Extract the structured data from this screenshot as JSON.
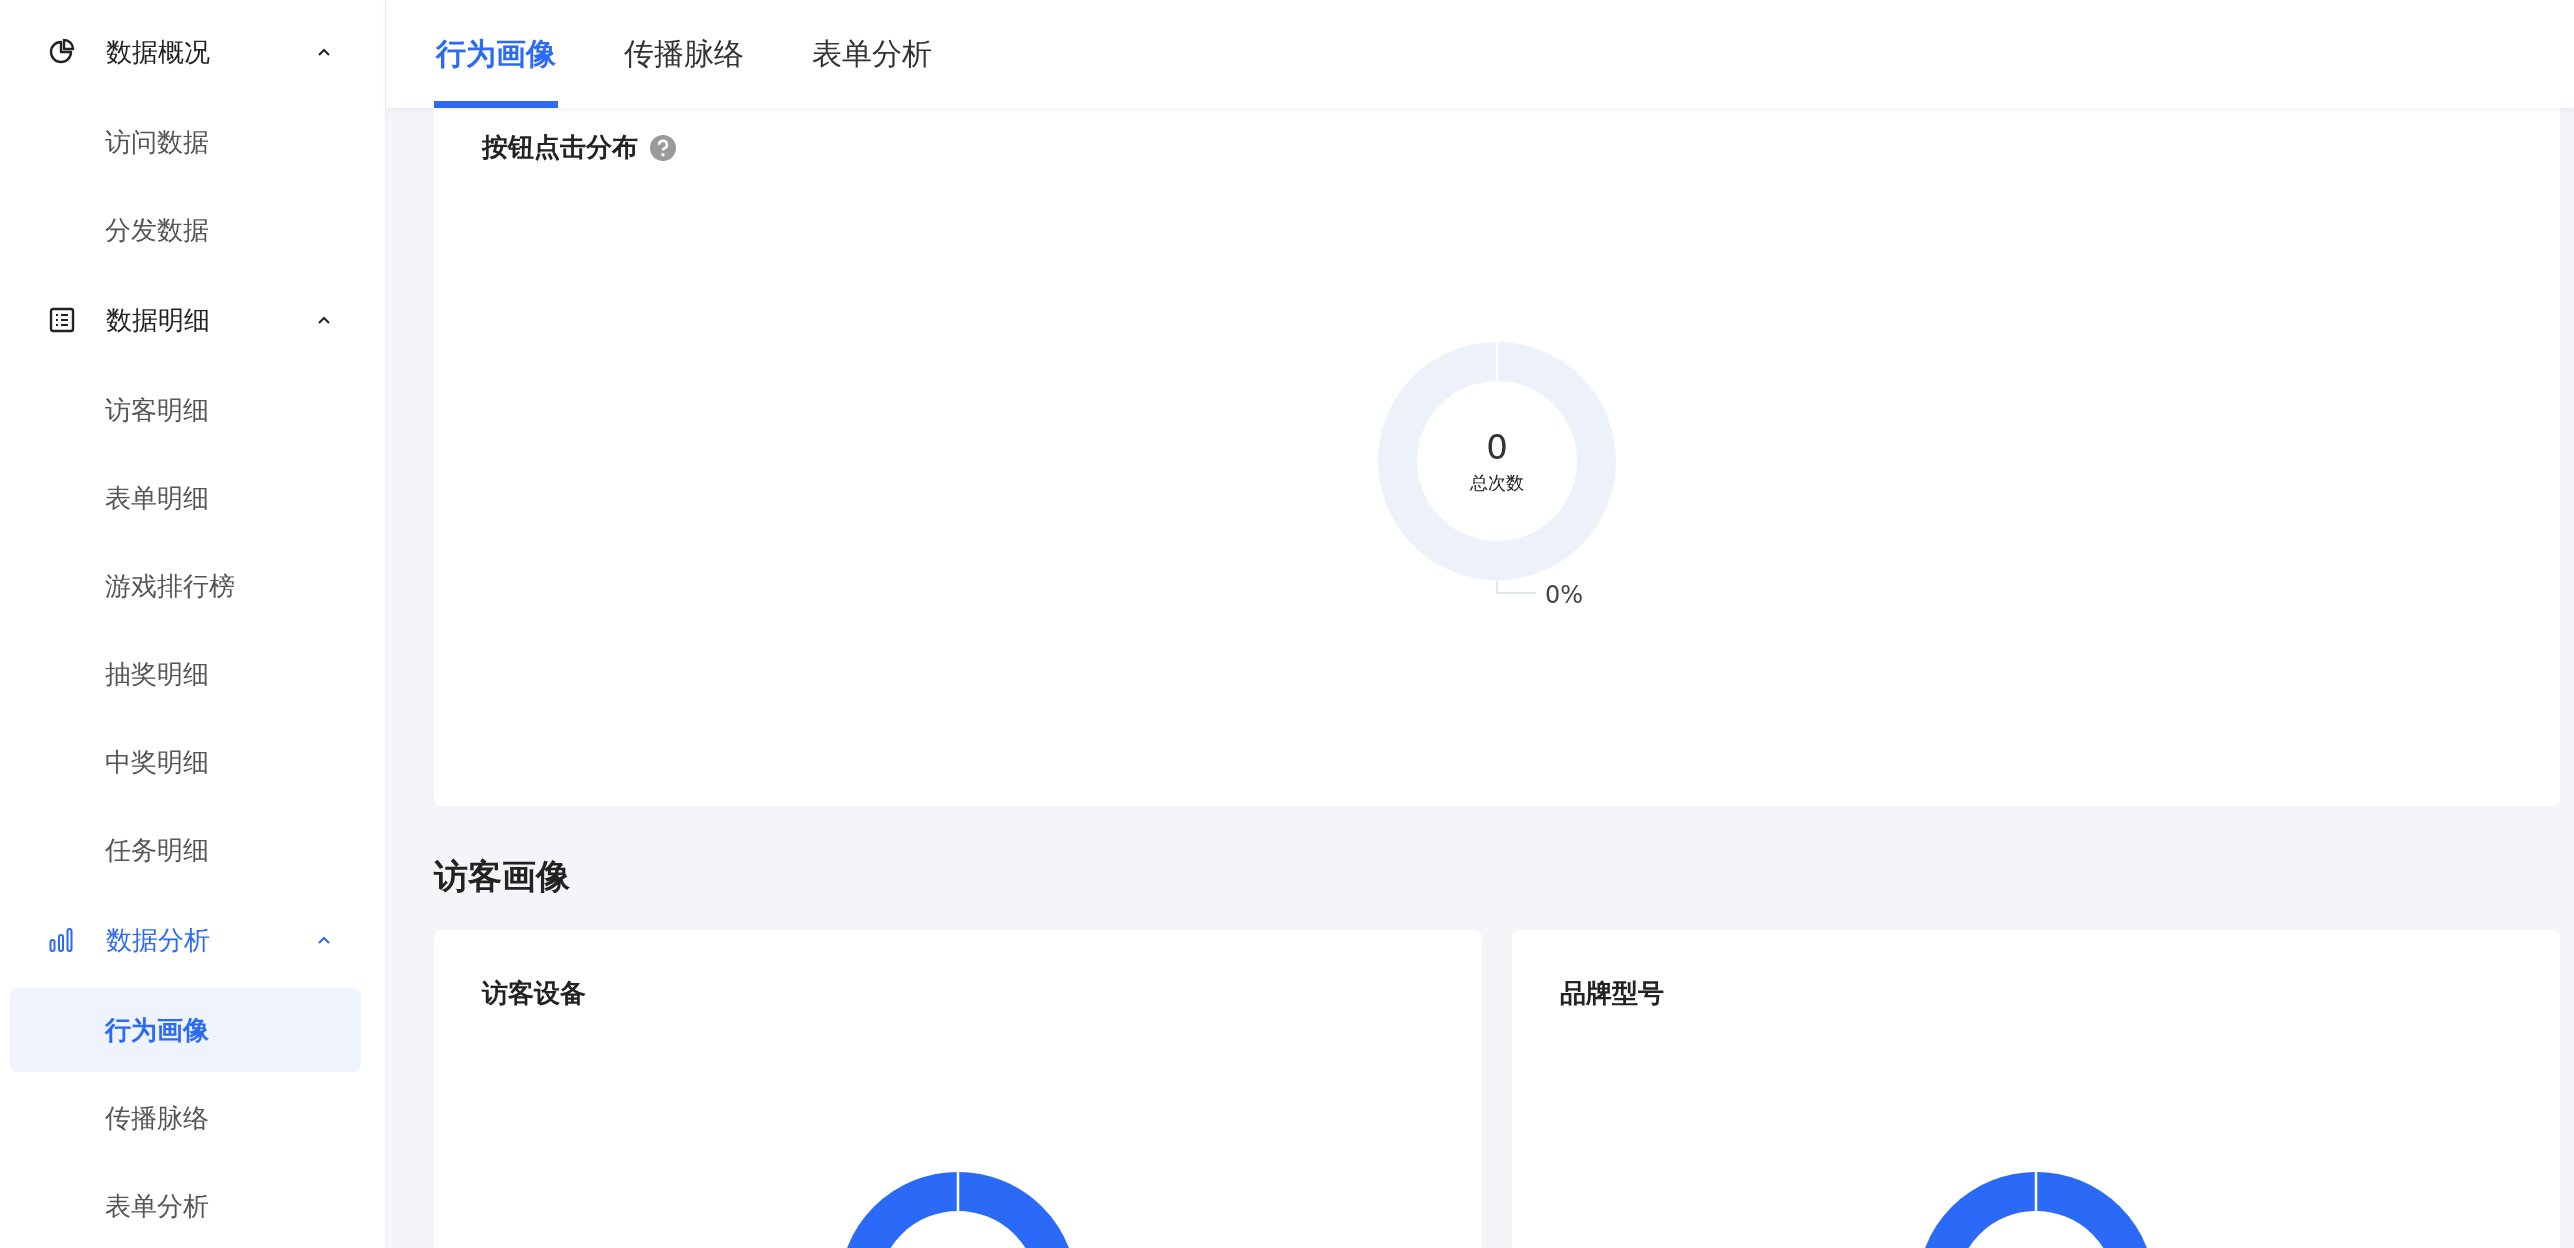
{
  "sidebar": {
    "groups": [
      {
        "label": "数据概况",
        "kind": "pie",
        "expanded": true,
        "items": [
          {
            "label": "访问数据",
            "selected": false
          },
          {
            "label": "分发数据",
            "selected": false
          }
        ]
      },
      {
        "label": "数据明细",
        "kind": "list",
        "expanded": true,
        "items": [
          {
            "label": "访客明细",
            "selected": false
          },
          {
            "label": "表单明细",
            "selected": false
          },
          {
            "label": "游戏排行榜",
            "selected": false
          },
          {
            "label": "抽奖明细",
            "selected": false
          },
          {
            "label": "中奖明细",
            "selected": false
          },
          {
            "label": "任务明细",
            "selected": false
          }
        ]
      },
      {
        "label": "数据分析",
        "kind": "bars",
        "expanded": true,
        "items": [
          {
            "label": "行为画像",
            "selected": true
          },
          {
            "label": "传播脉络",
            "selected": false
          },
          {
            "label": "表单分析",
            "selected": false
          }
        ]
      }
    ]
  },
  "tabs": [
    {
      "label": "行为画像",
      "selected": true
    },
    {
      "label": "传播脉络",
      "selected": false
    },
    {
      "label": "表单分析",
      "selected": false
    }
  ],
  "click_card": {
    "title": "按钮点击分布",
    "total": "0",
    "total_label": "总次数",
    "slice_label": "0%"
  },
  "section_title": "访客画像",
  "visitor_cards": [
    {
      "title": "访客设备"
    },
    {
      "title": "品牌型号"
    }
  ]
}
